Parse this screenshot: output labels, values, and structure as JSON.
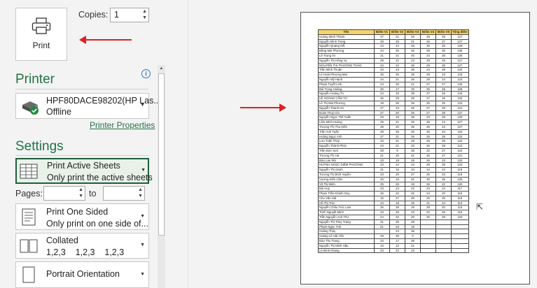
{
  "print_button": {
    "label": "Print",
    "icon": "printer-icon"
  },
  "copies": {
    "label": "Copies:",
    "value": "1"
  },
  "printer": {
    "section_title": "Printer",
    "name": "HPF80DACE98202(HP Las...",
    "status": "Offline",
    "properties_link": "Printer Properties"
  },
  "settings": {
    "section_title": "Settings",
    "print_what": {
      "title": "Print Active Sheets",
      "subtitle": "Only print the active sheets"
    },
    "pages_label": "Pages:",
    "to_label": "to",
    "sides": {
      "title": "Print One Sided",
      "subtitle": "Only print on one side of..."
    },
    "collation": {
      "title": "Collated",
      "subtitle": "1,2,3    1,2,3    1,2,3"
    },
    "orientation": {
      "title": "Portrait Orientation"
    }
  },
  "accent_color": "#217346",
  "sheet": {
    "headers": [
      "Tên",
      "Điểm V1",
      "Điểm V2",
      "Điểm V3",
      "Điểm V4",
      "Điểm V5",
      "Tổng điểm"
    ],
    "rows": [
      [
        "Hoàng Minh Thành",
        "27",
        "21",
        "26",
        "28",
        "25",
        "127"
      ],
      [
        "Nguyễn Đình Trọng",
        "28",
        "25",
        "21",
        "26",
        "27",
        "127"
      ],
      [
        "Nguyễn Quang Kết",
        "24",
        "24",
        "26",
        "30",
        "25",
        "129"
      ],
      [
        "Đặng Mai Phương",
        "24",
        "25",
        "32",
        "29",
        "25",
        "135"
      ],
      [
        "Lê Trọng Ân",
        "21",
        "21",
        "40",
        "24",
        "29",
        "135"
      ],
      [
        "Nguyễn Thị Hồng Vy",
        "29",
        "22",
        "23",
        "28",
        "25",
        "127"
      ],
      [
        "NGUYỄN THỊ PHƯƠNG THẢO",
        "24",
        "22",
        "26",
        "29",
        "26",
        "127"
      ],
      [
        "Trần Minh Thuận",
        "23",
        "23",
        "36",
        "24",
        "28",
        "134"
      ],
      [
        "Lê Hoài Phương Mai",
        "26",
        "26",
        "29",
        "29",
        "23",
        "133"
      ],
      [
        "Nguyễn Mỹ Hạnh",
        "24",
        "21",
        "26",
        "28",
        "24",
        "123"
      ],
      [
        "Phạm Tuyết Linh",
        "24",
        "26",
        "21",
        "27",
        "27",
        "125"
      ],
      [
        "Bùi Trọng Hoàng",
        "25",
        "17",
        "33",
        "25",
        "28",
        "128"
      ],
      [
        "Nguyễn Hoàng Tú",
        "24",
        "18",
        "38",
        "27",
        "26",
        "133"
      ],
      [
        "LÊ HOÀNG CẨM TÚ",
        "26",
        "29",
        "29",
        "27",
        "25",
        "132"
      ],
      [
        "Lê Thị Mai Phương",
        "18",
        "25",
        "26",
        "25",
        "25",
        "122"
      ],
      [
        "Nguyễn Thanh Hà",
        "27",
        "23",
        "26",
        "27",
        "28",
        "121"
      ],
      [
        "Đoàn Thuý Chi",
        "27",
        "20",
        "25",
        "27",
        "28",
        "127"
      ],
      [
        "Nguyễn Ngọc Thế Tuấn",
        "23",
        "19",
        "35",
        "23",
        "29",
        "129"
      ],
      [
        "Lâm Minh Hoàng",
        "29",
        "21",
        "25",
        "28",
        "24",
        "127"
      ],
      [
        "Trương Thị Thu Hiền",
        "29",
        "20",
        "26",
        "26",
        "23",
        "127"
      ],
      [
        "Trần Anh Tuấn",
        "29",
        "25",
        "20",
        "26",
        "24",
        "124"
      ],
      [
        "Hoàng Ngọc Anh",
        "27",
        "21",
        "25",
        "25",
        "28",
        "124"
      ],
      [
        "Lưu Tuấn Thủy",
        "24",
        "21",
        "28",
        "25",
        "25",
        "123"
      ],
      [
        "Nguyễn Thành Phúc",
        "24",
        "21",
        "23",
        "26",
        "28",
        "122"
      ],
      [
        "Trần Đức Sơn",
        "28",
        "9",
        "36",
        "22",
        "27",
        "122"
      ],
      [
        "Trương Thị Hà",
        "21",
        "20",
        "31",
        "25",
        "27",
        "121"
      ],
      [
        "Đào Lan Nhi",
        "23",
        "19",
        "29",
        "26",
        "23",
        "120"
      ],
      [
        "HUỲNH NGỌC DIỄM PHƯƠNG",
        "23",
        "24",
        "24",
        "28",
        "25",
        "124"
      ],
      [
        "Nguyễn Thị Oanh",
        "21",
        "16",
        "34",
        "24",
        "24",
        "119"
      ],
      [
        "Trương Thị Bích Huyền",
        "23",
        "20",
        "27",
        "26",
        "23",
        "119"
      ],
      [
        "Vương Kiến Cẩm",
        "23",
        "16",
        "31",
        "30",
        "25",
        "125"
      ],
      [
        "Vũ Thị Miên",
        "25",
        "26",
        "19",
        "26",
        "22",
        "120"
      ],
      [
        "Bùi Huy",
        "23",
        "24",
        "22",
        "24",
        "24",
        "117"
      ],
      [
        "Phạm Trần Khánh Duy",
        "26",
        "22",
        "31",
        "24",
        "20",
        "115"
      ],
      [
        "Chu Văn Hải",
        "15",
        "27",
        "26",
        "26",
        "25",
        "119"
      ],
      [
        "Hồ Thị Trúc",
        "24",
        "19",
        "25",
        "21",
        "24",
        "113"
      ],
      [
        "Nguyễn Châu Trúc Lam",
        "25",
        "28",
        "29",
        "29",
        "20",
        "116"
      ],
      [
        "Trịnh Nguyệt Minh",
        "23",
        "25",
        "23",
        "22",
        "25",
        "116"
      ],
      [
        "Trần Nguyễn Anh Thư",
        "24",
        "22",
        "20",
        "25",
        "28",
        "120"
      ],
      [
        "Nguyễn Thị Thủy Trang",
        "21",
        "25",
        "28",
        "",
        "",
        ""
      ],
      [
        "Phạm Ngọc Ánh",
        "21",
        "23",
        "19",
        "",
        "",
        ""
      ],
      [
        "Hoàng Thủy",
        "",
        "24",
        "36",
        "",
        "",
        ""
      ],
      [
        "Hoàng Lê Hải Yến",
        "29",
        "30",
        "0",
        "",
        "",
        ""
      ],
      [
        "Đào Thu Trang",
        "23",
        "17",
        "28",
        "",
        "",
        ""
      ],
      [
        "Nguyễn Thị Minh Hậu",
        "23",
        "12",
        "21",
        "",
        "",
        ""
      ],
      [
        "Lê Đình Khang",
        "23",
        "23",
        "23",
        "",
        "",
        ""
      ]
    ]
  }
}
